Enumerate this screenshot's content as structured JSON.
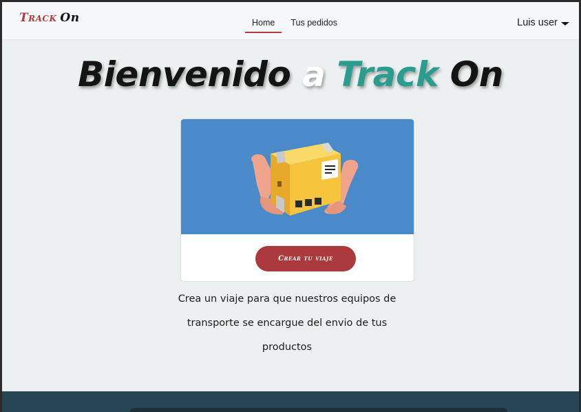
{
  "navbar": {
    "brand_track": "Track",
    "brand_on": "On",
    "links": [
      {
        "label": "Home",
        "active": true
      },
      {
        "label": "Tus pedidos",
        "active": false
      }
    ],
    "user": "Luis user"
  },
  "hero": {
    "word1": "Bienvenido",
    "word2": "a",
    "word3": "Track",
    "word4": "On"
  },
  "card": {
    "image_icon": "package-in-hands-icon",
    "button_label": "Crear tu viaje"
  },
  "description": "Crea un viaje para que nuestros equipos de transporte se encargue del envio de tus productos",
  "colors": {
    "accent_red": "#aa3a3c",
    "teal": "#2a9d8f",
    "card_blue": "#4a8ac8",
    "footer": "#264653",
    "page_bg": "#edf0f0"
  }
}
